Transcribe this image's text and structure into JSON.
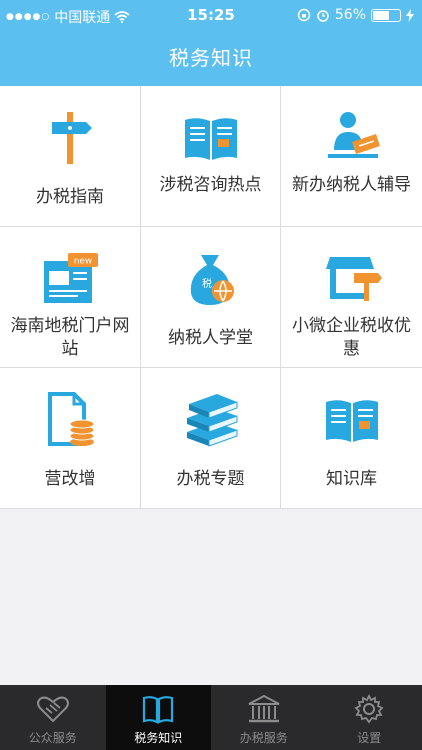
{
  "status": {
    "carrier": "中国联通",
    "time": "15:25",
    "battery": "56%",
    "battery_level": 0.56
  },
  "header": {
    "title": "税务知识"
  },
  "grid": [
    {
      "label": "办税指南",
      "icon": "signpost-icon"
    },
    {
      "label": "涉税咨询热点",
      "icon": "open-book-icon"
    },
    {
      "label": "新办纳税人辅导",
      "icon": "reading-person-icon"
    },
    {
      "label": "海南地税门户网站",
      "icon": "website-new-icon"
    },
    {
      "label": "纳税人学堂",
      "icon": "money-bag-globe-icon"
    },
    {
      "label": "小微企业税收优惠",
      "icon": "shop-sign-icon"
    },
    {
      "label": "营改增",
      "icon": "document-coins-icon"
    },
    {
      "label": "办税专题",
      "icon": "book-stack-icon"
    },
    {
      "label": "知识库",
      "icon": "open-book-icon"
    }
  ],
  "tabbar": [
    {
      "label": "公众服务",
      "icon": "handshake-heart-icon",
      "active": false
    },
    {
      "label": "税务知识",
      "icon": "book-icon",
      "active": true
    },
    {
      "label": "办税服务",
      "icon": "bank-building-icon",
      "active": false
    },
    {
      "label": "设置",
      "icon": "gear-icon",
      "active": false
    }
  ],
  "colors": {
    "accent": "#5bc0f0",
    "icon_blue": "#29a8e0",
    "icon_orange": "#f29331",
    "tabbar_bg": "#2a2a2c"
  }
}
